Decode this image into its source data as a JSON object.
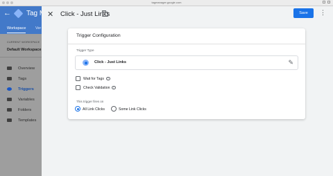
{
  "browser": {
    "url": "tagmanager.google.com"
  },
  "gtm": {
    "title": "Tag M",
    "tabs": [
      {
        "label": "Workspace"
      },
      {
        "label": "Ver"
      }
    ],
    "workspace_label": "CURRENT WORKSPACE",
    "workspace_name": "Default Workspace",
    "nav": [
      {
        "label": "Overview",
        "icon": "overview-icon"
      },
      {
        "label": "Tags",
        "icon": "tag-icon"
      },
      {
        "label": "Triggers",
        "icon": "trigger-icon",
        "active": true
      },
      {
        "label": "Variables",
        "icon": "variable-icon"
      },
      {
        "label": "Folders",
        "icon": "folder-icon"
      },
      {
        "label": "Templates",
        "icon": "template-icon"
      }
    ]
  },
  "panel": {
    "title": "Click - Just Links",
    "save_label": "Save",
    "card": {
      "title": "Trigger Configuration",
      "trigger_type_label": "Trigger Type",
      "trigger_type_name": "Click - Just Links",
      "options": [
        {
          "label": "Wait for Tags",
          "checked": false
        },
        {
          "label": "Check Validation",
          "checked": false
        }
      ],
      "fires_on_label": "This trigger fires on",
      "fires_on_options": [
        {
          "label": "All Link Clicks",
          "selected": true
        },
        {
          "label": "Some Link Clicks",
          "selected": false
        }
      ]
    }
  },
  "colors": {
    "accent": "#1a73e8",
    "header": "#4279c9"
  }
}
